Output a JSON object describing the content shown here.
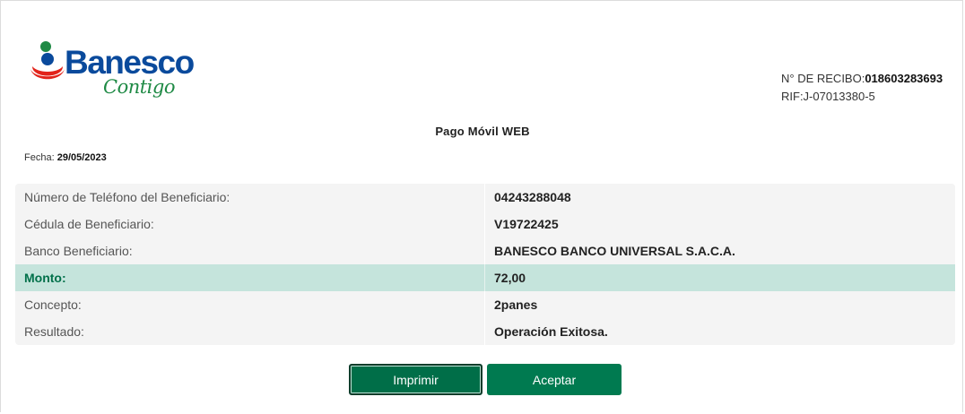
{
  "brand": {
    "name": "Banesco",
    "tagline": "Contigo",
    "colors": {
      "blue": "#0a4a9c",
      "green": "#1f8a45",
      "red": "#e2231a",
      "accent": "#007a50"
    }
  },
  "receipt": {
    "number_label": "N° DE RECIBO:",
    "number_value": "018603283693",
    "rif": "RIF:J-07013380-5"
  },
  "title": "Pago Móvil WEB",
  "date": {
    "label": "Fecha:",
    "value": "29/05/2023"
  },
  "details": [
    {
      "label": "Número de Teléfono del Beneficiario:",
      "value": "04243288048"
    },
    {
      "label": "Cédula de Beneficiario:",
      "value": "V19722425"
    },
    {
      "label": "Banco Beneficiario:",
      "value": "BANESCO BANCO UNIVERSAL S.A.C.A."
    },
    {
      "label": "Monto:",
      "value": "72,00"
    },
    {
      "label": "Concepto:",
      "value": "2panes"
    },
    {
      "label": "Resultado:",
      "value": "Operación Exitosa."
    }
  ],
  "actions": {
    "print_label": "Imprimir",
    "accept_label": "Aceptar"
  }
}
